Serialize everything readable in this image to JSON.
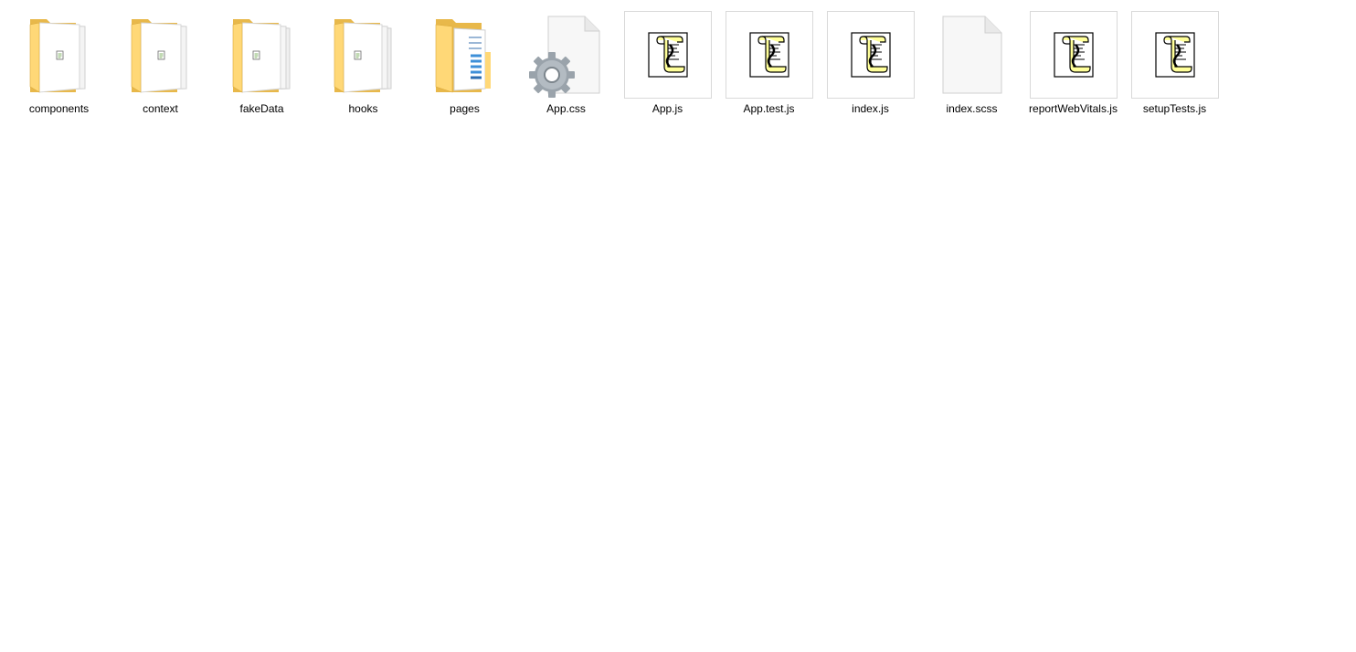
{
  "explorer": {
    "items": [
      {
        "name": "components",
        "type": "folder",
        "icon": "folder-icon"
      },
      {
        "name": "context",
        "type": "folder",
        "icon": "folder-icon"
      },
      {
        "name": "fakeData",
        "type": "folder",
        "icon": "folder-icon"
      },
      {
        "name": "hooks",
        "type": "folder",
        "icon": "folder-icon"
      },
      {
        "name": "pages",
        "type": "folder",
        "icon": "folder-with-documents-icon"
      },
      {
        "name": "App.css",
        "type": "file",
        "icon": "settings-file-icon"
      },
      {
        "name": "App.js",
        "type": "file",
        "icon": "script-file-icon"
      },
      {
        "name": "App.test.js",
        "type": "file",
        "icon": "script-file-icon"
      },
      {
        "name": "index.js",
        "type": "file",
        "icon": "script-file-icon"
      },
      {
        "name": "index.scss",
        "type": "file",
        "icon": "blank-file-icon"
      },
      {
        "name": "reportWebVitals.js",
        "type": "file",
        "icon": "script-file-icon"
      },
      {
        "name": "setupTests.js",
        "type": "file",
        "icon": "script-file-icon"
      }
    ]
  },
  "colors": {
    "folder_back": "#E8B84A",
    "folder_front": "#FFD877",
    "selection_border": "#D9D9D9",
    "scroll_yellow": "#FFFF99"
  }
}
